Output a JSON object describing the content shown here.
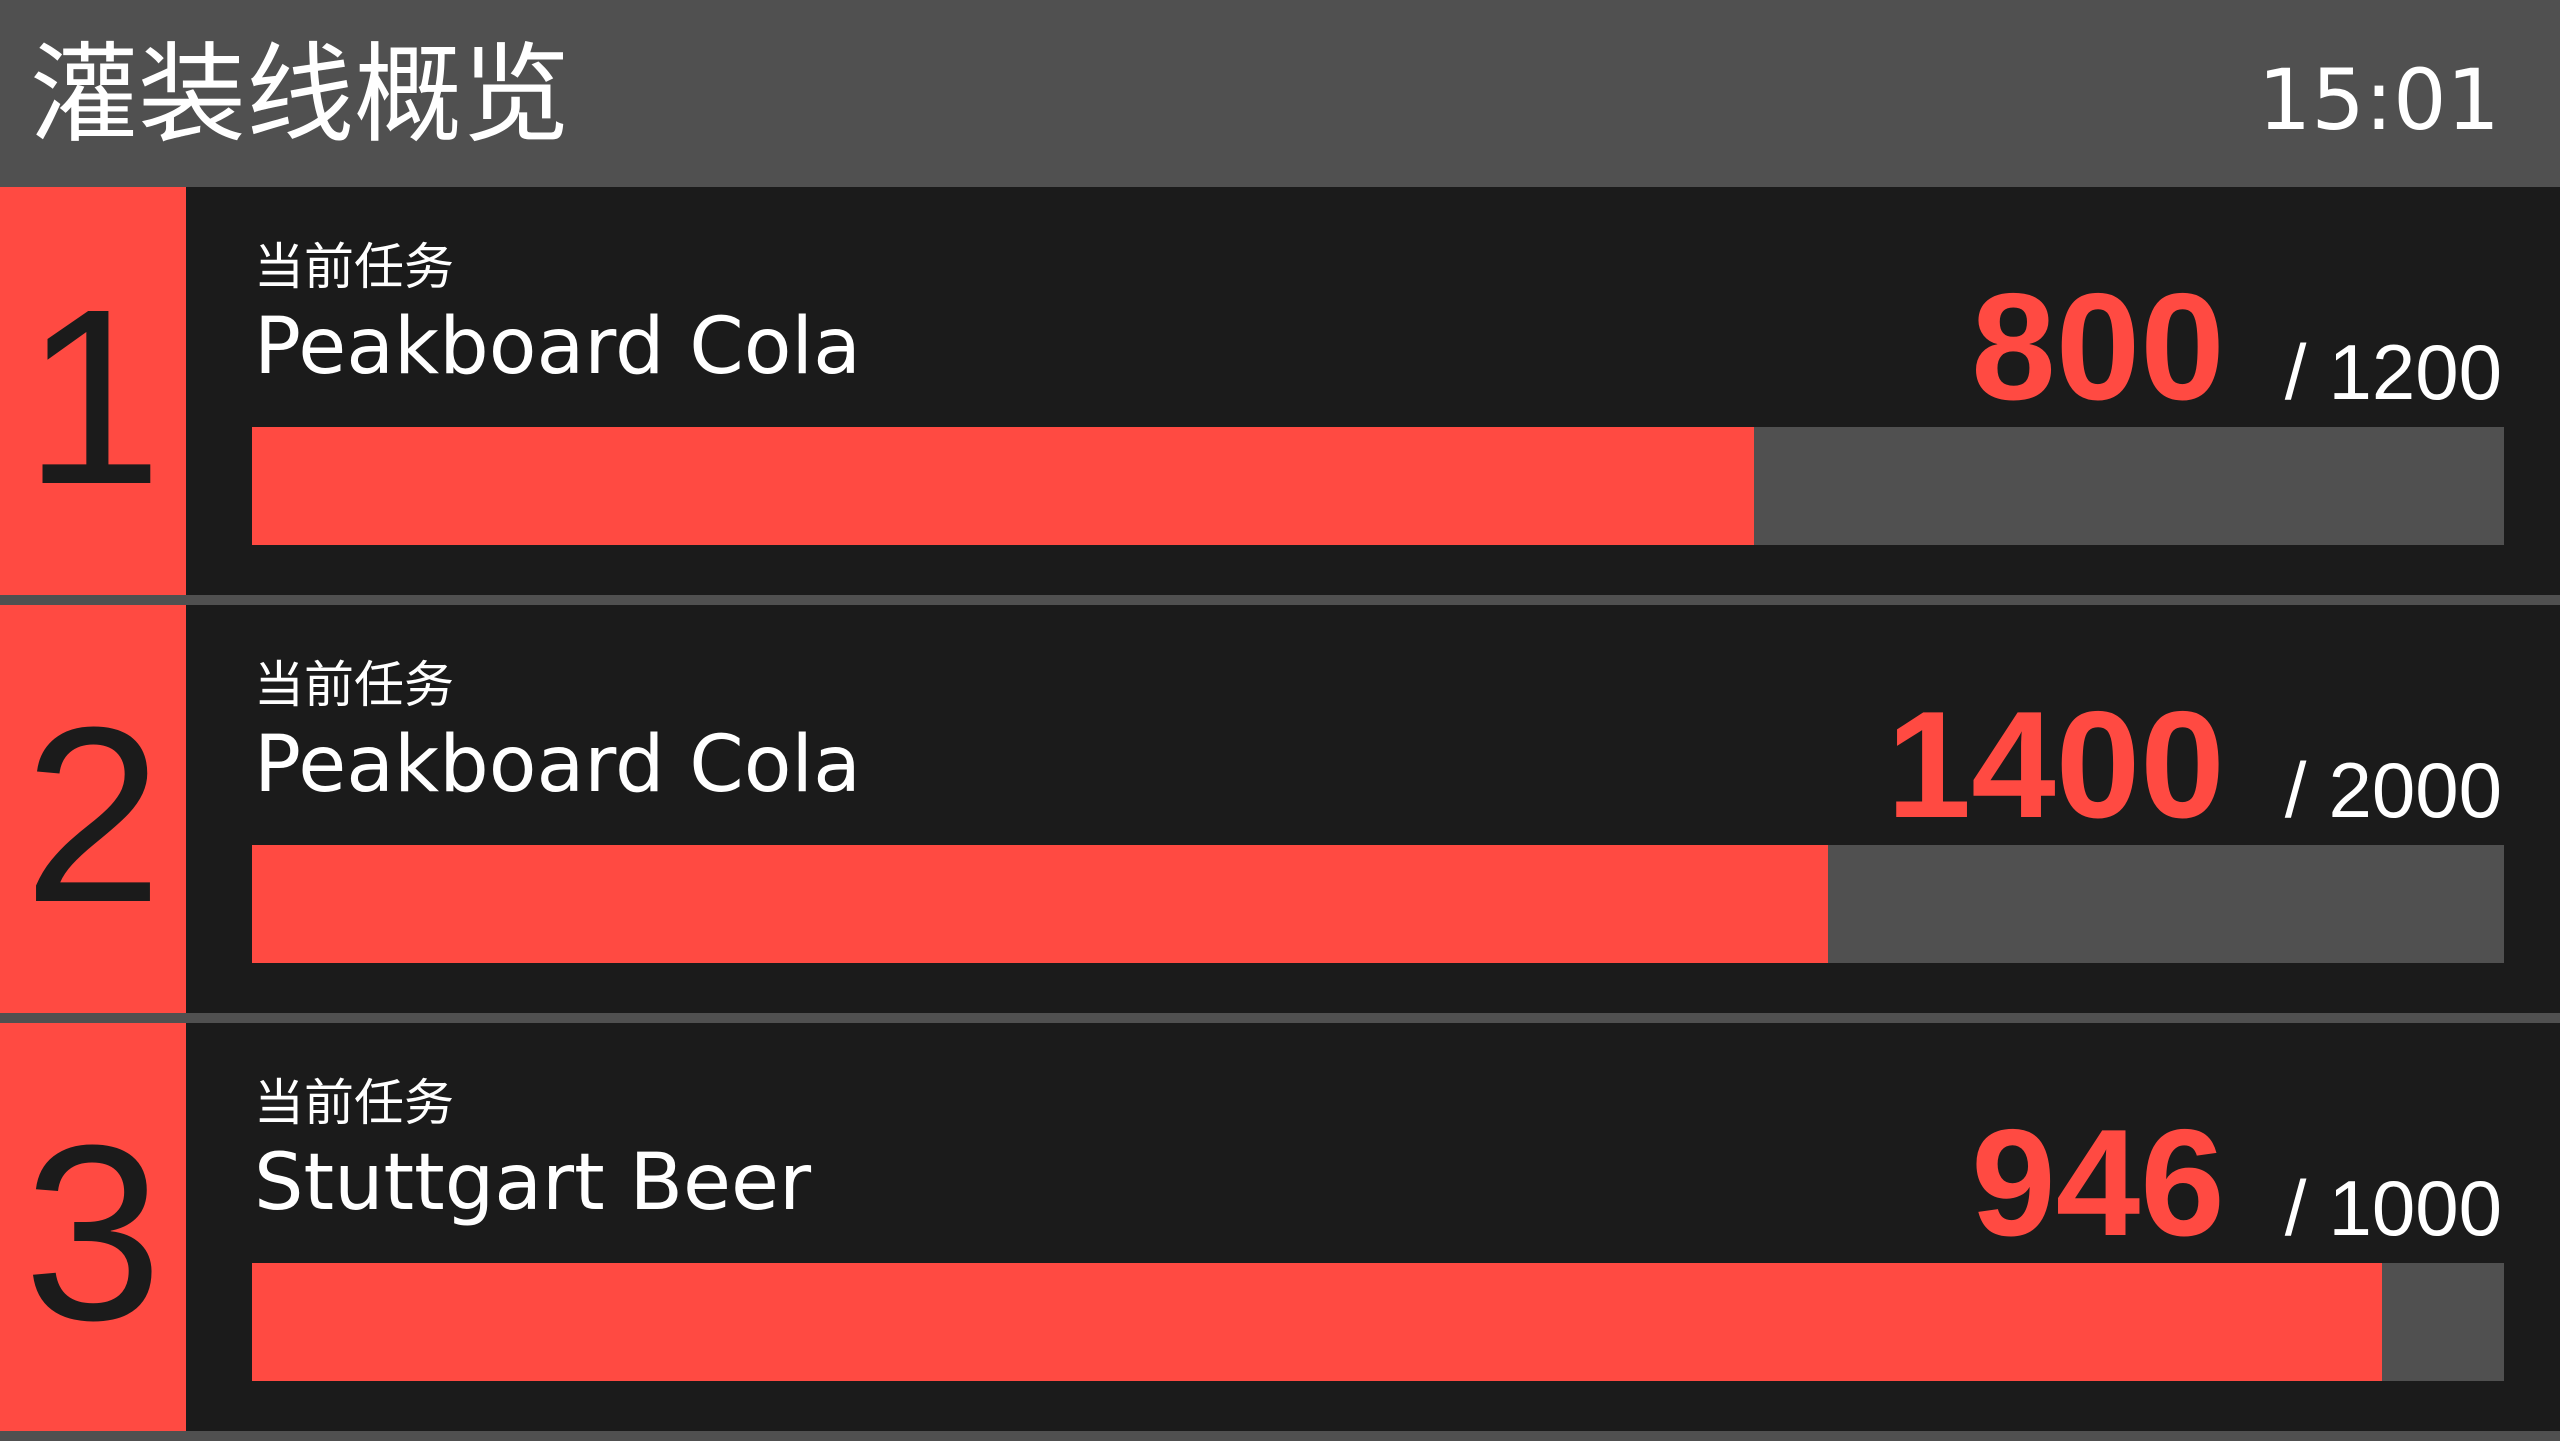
{
  "header": {
    "title": "灌装线概览",
    "clock": "15:01"
  },
  "colors": {
    "accent": "#ff4a42",
    "header_bg": "#505050",
    "panel_bg": "#1b1b1b",
    "track": "#505050",
    "text": "#ffffff",
    "badge_text": "#1b1b1b"
  },
  "lines": [
    {
      "number": "1",
      "task_label": "当前任务",
      "product": "Peakboard Cola",
      "current": "800",
      "separator": "/",
      "target": "1200",
      "progress": 0.667
    },
    {
      "number": "2",
      "task_label": "当前任务",
      "product": "Peakboard Cola",
      "current": "1400",
      "separator": "/",
      "target": "2000",
      "progress": 0.7
    },
    {
      "number": "3",
      "task_label": "当前任务",
      "product": "Stuttgart Beer",
      "current": "946",
      "separator": "/",
      "target": "1000",
      "progress": 0.946
    }
  ]
}
